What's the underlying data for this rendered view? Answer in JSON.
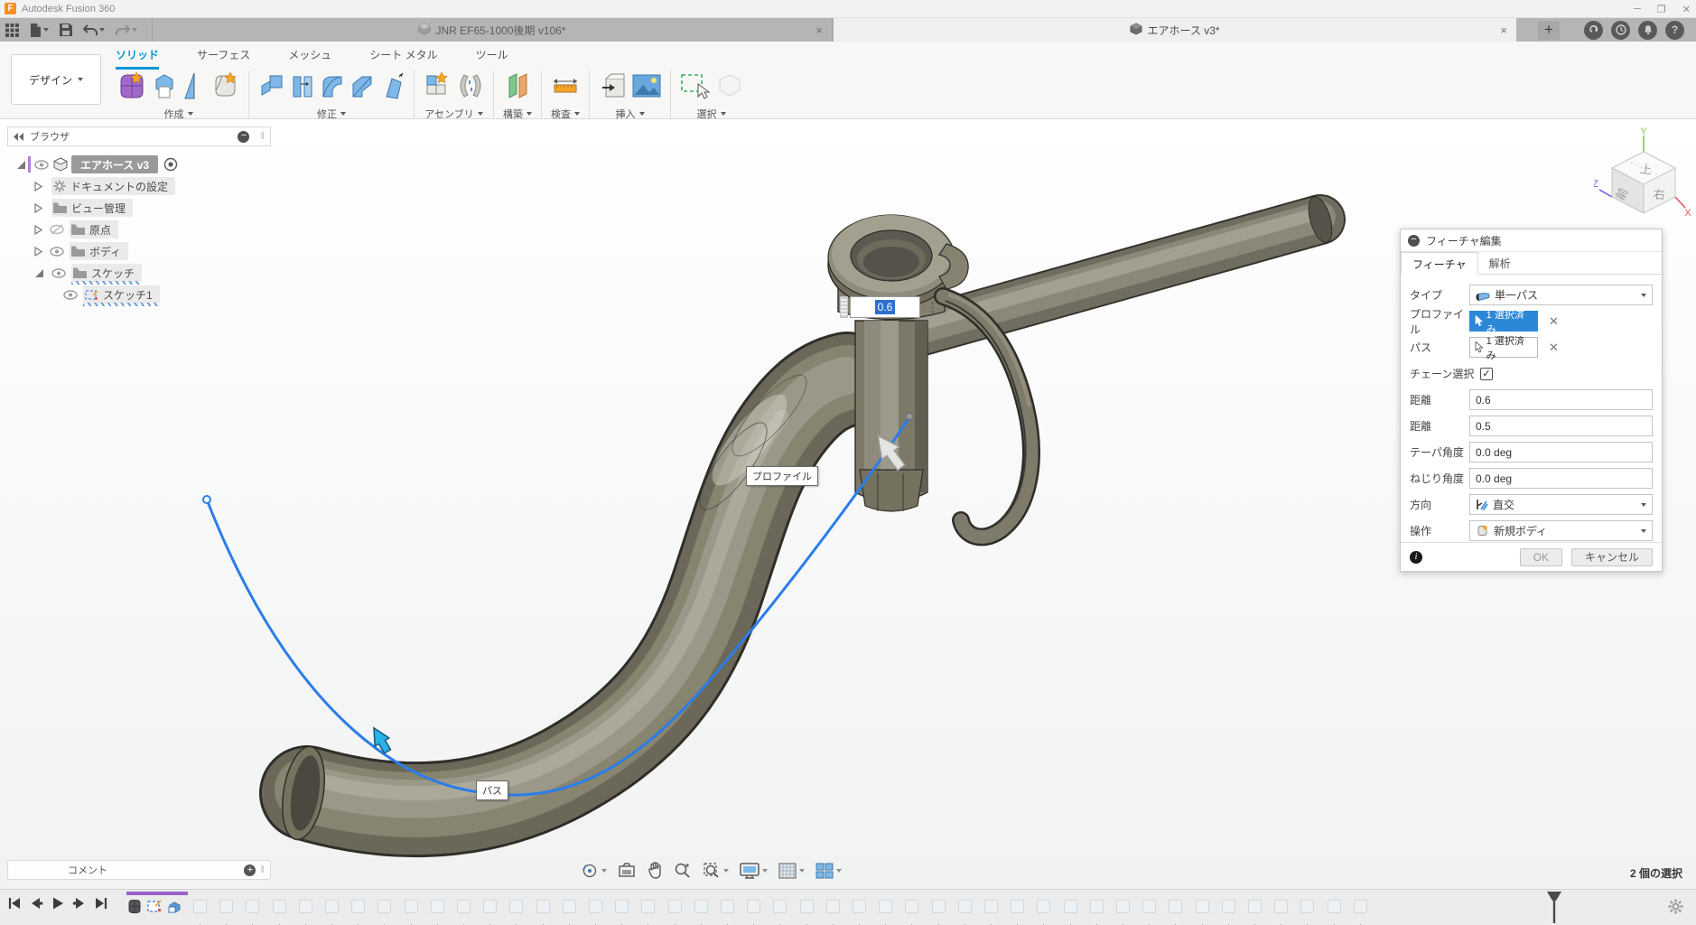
{
  "window": {
    "title": "Autodesk Fusion 360"
  },
  "doc_tabs": [
    {
      "label": "JNR EF65-1000後期 v106*",
      "active": false
    },
    {
      "label": "エアホース v3*",
      "active": true
    }
  ],
  "ribbon": {
    "design_menu": "デザイン",
    "tabs": [
      {
        "label": "ソリッド",
        "active": true
      },
      {
        "label": "サーフェス",
        "active": false
      },
      {
        "label": "メッシュ",
        "active": false
      },
      {
        "label": "シート メタル",
        "active": false
      },
      {
        "label": "ツール",
        "active": false
      }
    ],
    "groups": [
      {
        "label": "作成"
      },
      {
        "label": "修正"
      },
      {
        "label": "アセンブリ"
      },
      {
        "label": "構築"
      },
      {
        "label": "検査"
      },
      {
        "label": "挿入"
      },
      {
        "label": "選択"
      }
    ]
  },
  "browser": {
    "header": "ブラウザ",
    "root": "エアホース v3",
    "items": [
      {
        "label": "ドキュメントの設定"
      },
      {
        "label": "ビュー管理"
      },
      {
        "label": "原点"
      },
      {
        "label": "ボディ"
      },
      {
        "label": "スケッチ"
      },
      {
        "label": "スケッチ1"
      }
    ]
  },
  "viewcube": {
    "top": "上",
    "front": "前",
    "right": "右",
    "axis_x": "X",
    "axis_y": "Y",
    "axis_z": "Z"
  },
  "canvas": {
    "floating_input_value": "0.6",
    "profile_tooltip": "プロファイル",
    "path_tooltip": "パス"
  },
  "dialog": {
    "title": "フィーチャ編集",
    "tabs": [
      {
        "label": "フィーチャ",
        "active": true
      },
      {
        "label": "解析",
        "active": false
      }
    ],
    "rows": [
      {
        "label": "タイプ",
        "value": "単一パス"
      },
      {
        "label": "プロファイル",
        "value": "1 選択済み"
      },
      {
        "label": "パス",
        "value": "1 選択済み"
      },
      {
        "label": "チェーン選択",
        "checked": true
      },
      {
        "label": "距離",
        "value": "0.6"
      },
      {
        "label": "距離",
        "value": "0.5"
      },
      {
        "label": "テーパ角度",
        "value": "0.0 deg"
      },
      {
        "label": "ねじり角度",
        "value": "0.0 deg"
      },
      {
        "label": "方向",
        "value": "直交"
      },
      {
        "label": "操作",
        "value": "新規ボディ"
      }
    ],
    "ok": "OK",
    "cancel": "キャンセル"
  },
  "comment_panel": {
    "label": "コメント"
  },
  "status": {
    "selection": "2 個の選択"
  },
  "timeline": {
    "suppressed_count": 45,
    "suppressed_spacing": 29.2
  },
  "icons": {
    "app_logo": "F-logo",
    "titlebar": [
      "minimize-icon",
      "maximize-icon",
      "close-icon"
    ],
    "appbar": [
      "grid-menu-icon",
      "file-icon",
      "save-icon",
      "undo-icon",
      "redo-icon"
    ],
    "tabbar_right": [
      "extensions-icon",
      "job-status-icon",
      "notifications-icon",
      "help-icon"
    ],
    "browser": [
      "eye-icon",
      "eye-off-icon",
      "gear-icon",
      "folder-icon",
      "cube-icon",
      "sketch-icon",
      "radio-icon"
    ],
    "view_toolbar": [
      "orbit-icon",
      "look-at-icon",
      "pan-icon",
      "zoom-icon",
      "fit-icon",
      "display-settings-icon",
      "grid-icon",
      "viewports-icon"
    ],
    "timeline": [
      "skip-start-icon",
      "step-back-icon",
      "play-icon",
      "step-forward-icon",
      "skip-end-icon",
      "gear-icon"
    ]
  },
  "colors": {
    "accent_blue": "#0696d7",
    "selection_blue": "#2b7de9",
    "timeline_purple": "#9c63cc",
    "model_gray": "#8b887a",
    "tabbar_gray": "#b5b5b5"
  }
}
